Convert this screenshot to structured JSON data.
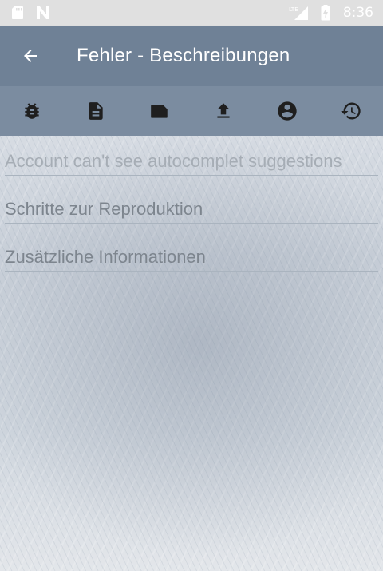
{
  "status_bar": {
    "time": "8:36",
    "network_label": "LTE",
    "icons": [
      "sd-card-icon",
      "n-notification-icon",
      "lte-signal-icon",
      "battery-charging-icon"
    ]
  },
  "app_bar": {
    "title": "Fehler - Beschreibungen",
    "back_icon": "arrow-back-icon"
  },
  "tabs": [
    {
      "name": "bug-icon"
    },
    {
      "name": "document-icon"
    },
    {
      "name": "folded-card-icon"
    },
    {
      "name": "upload-icon"
    },
    {
      "name": "account-circle-icon"
    },
    {
      "name": "history-icon"
    }
  ],
  "form": {
    "summary": {
      "value": "",
      "placeholder": "Account can't see autocomplet suggestions"
    },
    "steps": {
      "value": "",
      "placeholder": "Schritte zur Reproduktion"
    },
    "additional": {
      "value": "",
      "placeholder": "Zusätzliche Informationen"
    }
  },
  "colors": {
    "status_bar": "#e0e0e0",
    "app_bar": "#6f8196",
    "tab_bar": "#7b8ca0",
    "icon_dark": "#1f1f1f"
  }
}
